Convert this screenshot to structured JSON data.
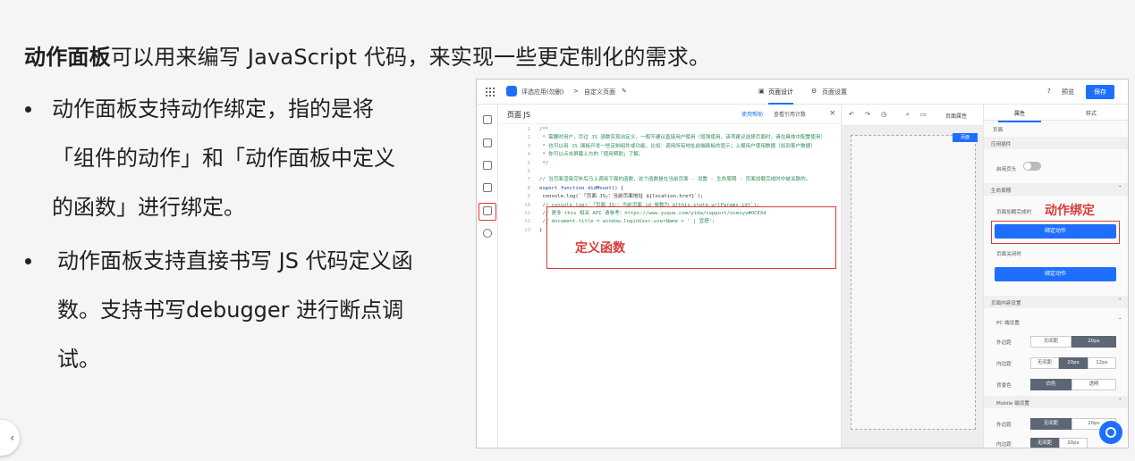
{
  "slide": {
    "title_bold": "动作面板",
    "title_rest": "可以用来编写 JavaScript 代码，来实现一些更定制化的需求。",
    "bullet1_lines": [
      "动作面板支持动作绑定，指的是将",
      "「组件的动作」和「动作面板中定义",
      "的函数」进行绑定。"
    ],
    "bullet2_lines": [
      "动作面板支持直接书写 JS 代码定义函",
      "数。支持书写debugger 进行断点调",
      "试。"
    ]
  },
  "app": {
    "app_name": "评选应用(勿删)",
    "breadcrumb_sep": ">",
    "page_name": "自定义页面",
    "tab_design": "页面设计",
    "tab_settings": "页面设置",
    "preview": "预览",
    "save": "保存"
  },
  "editor": {
    "title": "页面 JS",
    "tool1": "使用帮助",
    "tool2": "查看引用计数",
    "code_lines": [
      {
        "no": "1",
        "text": "/**",
        "cls": "c-green"
      },
      {
        "no": "2",
        "text": " * 需要时用户，尽过 JS 函数实现自定义，一般不建议直接用户使用（增强使用，该项建议选择页面时，请在具体中配置使用）",
        "cls": "c-green"
      },
      {
        "no": "3",
        "text": " * 也可以用 JS 面板开发一些定制组件或功能，比如：调用所有地址前端面板的显示；上报用户使用数据（如到客户数据）",
        "cls": "c-green"
      },
      {
        "no": "4",
        "text": " * 你可以点击屏幕上方的「使用帮助」了解。",
        "cls": "c-green"
      },
      {
        "no": "5",
        "text": " */",
        "cls": "c-green"
      },
      {
        "no": "6",
        "text": "",
        "cls": "c-dark"
      },
      {
        "no": "7",
        "text": "// 当页面渲染完毕后马上调用下面的函数，这个函数是在当前页面 - 设置 - 生命周期 - 页面加载完成时中被关联的。",
        "cls": "c-green"
      },
      {
        "no": "8",
        "text": "export function didMount() {",
        "cls": "c-blue"
      },
      {
        "no": "9",
        "text": "  console.log(`「页面 JS」：当前页面地址 ${location.href}`);",
        "cls": "c-dark"
      },
      {
        "no": "10",
        "text": "  // console.log(`「页面 JS」：当前页面 id 参数为 ${this.state.urlParams.id}`);",
        "cls": "c-green"
      },
      {
        "no": "11",
        "text": "  // 更多 this 相关 API 请参考：https://www.yuque.com/yida/support/ocmxyv#OCEXd",
        "cls": "c-green"
      },
      {
        "no": "12",
        "text": "  // document.title = window.loginUser.userName + ' | 宜搭';",
        "cls": "c-green"
      },
      {
        "no": "13",
        "text": "}",
        "cls": "c-blue"
      }
    ],
    "annotation": "定义函数"
  },
  "canvas": {
    "toolbar_label": "页面属性",
    "tag": "页面"
  },
  "panel": {
    "tab_props": "属性",
    "tab_style": "样式",
    "crumb": "页面",
    "group_page": "应用插件",
    "header_toggle_label": "启用页头",
    "section_lifecycle": "生命周期",
    "onload_label": "页面加载完成时",
    "bind_button": "绑定动作",
    "unload_label": "页面关闭时",
    "bind_button2": "绑定动作",
    "annotation": "动作绑定",
    "section_content": "页面内容设置",
    "pc_group": "PC 端设置",
    "row_h_margin": "外边距",
    "row_v_margin": "内边距",
    "row_bg": "背景色",
    "seg_none": "无间距",
    "seg_20": "20px",
    "seg_12": "12px",
    "seg_white": "白色",
    "seg_transparent": "透明",
    "mobile_group": "Mobile 端设置",
    "m_row_h": "外边距",
    "m_row_v": "内边距"
  }
}
